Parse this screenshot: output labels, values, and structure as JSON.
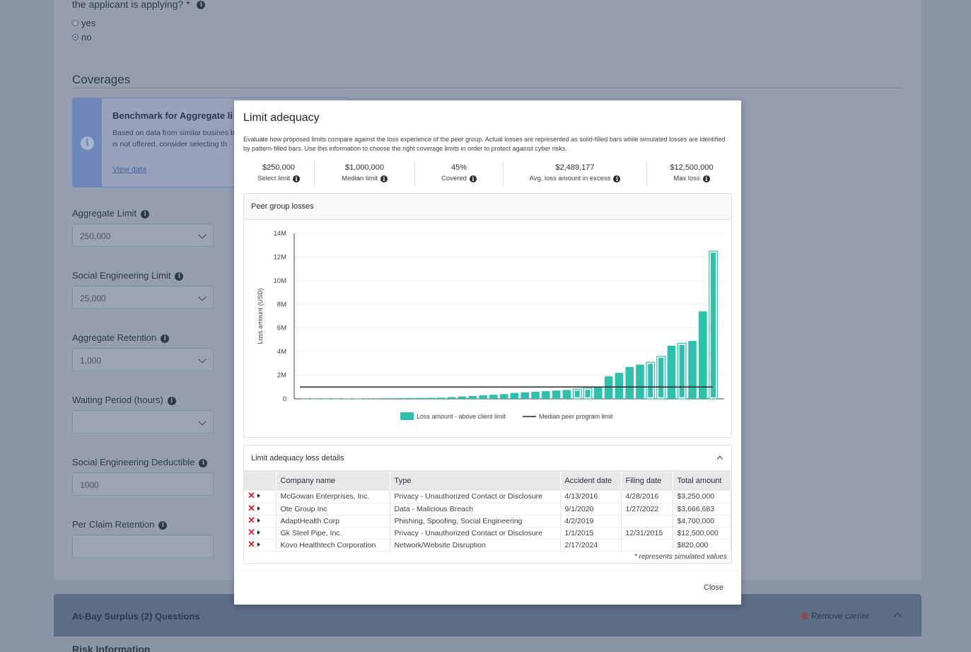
{
  "background": {
    "question_text": "the applicant is applying?",
    "required_mark": "*",
    "radio_options": [
      {
        "label": "yes",
        "selected": false
      },
      {
        "label": "no",
        "selected": true
      }
    ],
    "section_title": "Coverages",
    "benchmark": {
      "title": "Benchmark for Aggregate li",
      "body": "Based on data from similar busines benchmark for Aggregate limit is $ is not offered, consider selecting th",
      "link": "View data"
    },
    "fields": [
      {
        "label": "Aggregate Limit",
        "value": "250,000"
      },
      {
        "label": "Social Engineering Limit",
        "value": "25,000"
      },
      {
        "label": "Aggregate Retention",
        "value": "1,000"
      },
      {
        "label": "Waiting Period (hours)",
        "value": ""
      },
      {
        "label": "Social Engineering Deductible",
        "value": "1000"
      },
      {
        "label": "Per Claim Retention",
        "value": ""
      }
    ],
    "carrier_band": {
      "title": "At-Bay Surplus (2) Questions",
      "remove": "Remove carrier"
    },
    "bottom_text": "Risk Information"
  },
  "modal": {
    "title": "Limit adequacy",
    "description": "Evaluate how proposed limits compare against the loss experience of the peer group. Actual losses are represented as solid-filled bars while simulated losses are identified by pattern-filled bars. Use this information to choose the right coverage limits in order to protect against cyber risks.",
    "stats": [
      {
        "value": "$250,000",
        "label": "Select limit"
      },
      {
        "value": "$1,000,000",
        "label": "Median limit"
      },
      {
        "value": "45%",
        "label": "Covered"
      },
      {
        "value": "$2,489,177",
        "label": "Avg. loss amount in excess"
      },
      {
        "value": "$12,500,000",
        "label": "Max loss"
      }
    ],
    "chart_title": "Peer group losses",
    "details_title": "Limit adequacy loss details",
    "table": {
      "headers": [
        "Company name",
        "Type",
        "Accident date",
        "Filing date",
        "Total amount"
      ],
      "rows": [
        [
          "McGowan Enterprises, Inc.",
          "Privacy - Unauthorized Contact or Disclosure",
          "4/13/2016",
          "4/28/2016",
          "$3,250,000"
        ],
        [
          "Ote Group Inc",
          "Data - Malicious Breach",
          "9/1/2020",
          "1/27/2022",
          "$3,666,683"
        ],
        [
          "AdaptHealth Corp",
          "Phishing, Spoofing, Social Engineering",
          "4/2/2019",
          "",
          "$4,700,000"
        ],
        [
          "Gk Steel Pipe, Inc.",
          "Privacy - Unauthorized Contact or Disclosure",
          "1/1/2015",
          "12/31/2015",
          "$12,500,000"
        ],
        [
          "Kovo Healthtech Corporation",
          "Network/Website Disruption",
          "2/17/2024",
          "",
          "$820,000"
        ]
      ]
    },
    "simulated_note": "* represents simulated values",
    "close_label": "Close"
  },
  "chart_data": {
    "type": "bar",
    "ylabel": "Loss amount (USD)",
    "ylim": [
      0,
      14000000
    ],
    "y_ticks": [
      "0",
      "2M",
      "4M",
      "6M",
      "8M",
      "10M",
      "12M",
      "14M"
    ],
    "grid": true,
    "legend_position": "bottom",
    "series": [
      {
        "name": "Loss amount - above client limit",
        "color": "#2ebfad",
        "values": [
          10000,
          10000,
          15000,
          20000,
          25000,
          30000,
          35000,
          40000,
          50000,
          60000,
          70000,
          80000,
          90000,
          100000,
          150000,
          200000,
          250000,
          300000,
          350000,
          400000,
          500000,
          550000,
          600000,
          650000,
          700000,
          750000,
          820000,
          900000,
          1000000,
          1900000,
          2200000,
          2700000,
          2900000,
          3100000,
          3600000,
          4500000,
          4700000,
          4900000,
          7400000,
          12500000
        ],
        "simulated": [
          false,
          false,
          false,
          false,
          false,
          false,
          false,
          false,
          false,
          false,
          false,
          false,
          false,
          false,
          false,
          false,
          false,
          false,
          false,
          false,
          false,
          false,
          false,
          false,
          false,
          false,
          true,
          true,
          false,
          false,
          false,
          false,
          false,
          true,
          true,
          false,
          true,
          false,
          false,
          true
        ]
      },
      {
        "name": "Median peer program limit",
        "color": "#1f2328",
        "values": [
          1000000
        ]
      }
    ]
  }
}
